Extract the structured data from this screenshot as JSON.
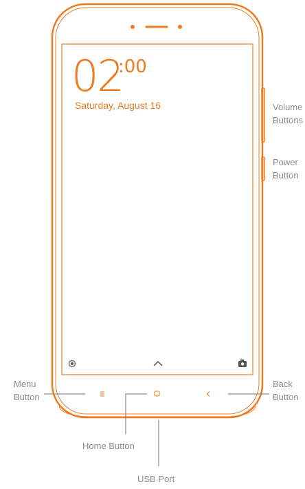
{
  "screen": {
    "time_hour": "02",
    "time_minute": ":00",
    "date": "Saturday, August 16"
  },
  "callouts": {
    "volume": [
      "Volume",
      "Buttons"
    ],
    "power": [
      "Power",
      "Button"
    ],
    "menu": [
      "Menu",
      "Button"
    ],
    "back": [
      "Back",
      "Button"
    ],
    "home": "Home Button",
    "usb": "USB Port"
  },
  "colors": {
    "device_outline": "#f07a1e",
    "callout_line": "#8c8c8c",
    "label_text": "#8c8c8c"
  },
  "icons": {
    "earpiece": "earpiece-slot",
    "front_camera": "front-camera-dot",
    "sensor": "sensor-dot",
    "lock_screen_left": "record-icon",
    "lock_screen_center": "chevron-up-icon",
    "lock_screen_right": "camera-icon",
    "nav_menu": "menu-icon",
    "nav_home": "home-icon",
    "nav_back": "back-icon"
  }
}
